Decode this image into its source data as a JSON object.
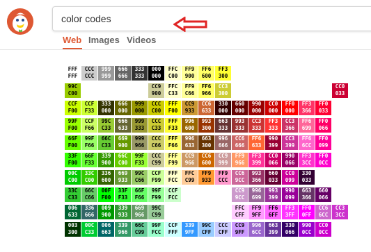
{
  "search": {
    "query": "color codes"
  },
  "tabs": [
    {
      "label": "Web",
      "active": true
    },
    {
      "label": "Images",
      "active": false
    },
    {
      "label": "Videos",
      "active": false
    }
  ],
  "colors": {
    "accent": "#de5833",
    "arrow": "#e02424"
  },
  "color_chart": {
    "rows": [
      [
        [
          "FFF",
          "FFF",
          "FFF",
          "#000"
        ],
        [
          "CCC",
          "CCC",
          "CCC",
          "#000"
        ],
        [
          "999",
          "999",
          "999",
          "#fff"
        ],
        [
          "666",
          "666",
          "666",
          "#fff"
        ],
        [
          "333",
          "333",
          "333",
          "#fff"
        ],
        [
          "000",
          "000",
          "000",
          "#fff"
        ],
        [
          "FFC",
          "C00",
          "FFC",
          "#000"
        ],
        [
          "FF9",
          "900",
          "FF9",
          "#000"
        ],
        [
          "FF6",
          "600",
          "FF6",
          "#000"
        ],
        [
          "FF3",
          "300",
          "FF3",
          "#000"
        ]
      ],
      [
        [
          "99C",
          "C00",
          "9C0",
          "#000"
        ],
        null,
        null,
        null,
        null,
        [
          "CC9",
          "900",
          "CC9",
          "#000"
        ],
        [
          "FFC",
          "C33",
          "FFC",
          "#000"
        ],
        [
          "FF9",
          "C66",
          "FF9",
          "#000"
        ],
        [
          "FF6",
          "966",
          "FF6",
          "#000"
        ],
        [
          "CC3",
          "300",
          "CC3",
          "#fff"
        ],
        null,
        null,
        null,
        null,
        null,
        null,
        [
          "CC0",
          "033",
          "C03",
          "#fff"
        ]
      ],
      [
        [
          "CCF",
          "F00",
          "CF0",
          "#000"
        ],
        [
          "CCF",
          "F33",
          "CF3",
          "#000"
        ],
        [
          "333",
          "000",
          "330",
          "#fff"
        ],
        [
          "666",
          "000",
          "660",
          "#fff"
        ],
        [
          "999",
          "000",
          "990",
          "#000"
        ],
        [
          "CCC",
          "C00",
          "CC0",
          "#000"
        ],
        [
          "FFF",
          "F00",
          "FF0",
          "#000"
        ],
        [
          "CC9",
          "933",
          "C93",
          "#000"
        ],
        [
          "CC6",
          "633",
          "C63",
          "#fff"
        ],
        [
          "330",
          "000",
          "300",
          "#fff"
        ],
        [
          "660",
          "000",
          "600",
          "#fff"
        ],
        [
          "990",
          "000",
          "900",
          "#fff"
        ],
        [
          "CC0",
          "000",
          "C00",
          "#fff"
        ],
        [
          "FF0",
          "000",
          "F00",
          "#fff"
        ],
        [
          "FF3",
          "366",
          "F36",
          "#fff"
        ],
        [
          "FF0",
          "033",
          "F03",
          "#fff"
        ]
      ],
      [
        [
          "99F",
          "F00",
          "9F0",
          "#000"
        ],
        [
          "CCF",
          "F66",
          "CF6",
          "#000"
        ],
        [
          "99C",
          "C33",
          "9C3",
          "#000"
        ],
        [
          "666",
          "633",
          "663",
          "#fff"
        ],
        [
          "999",
          "333",
          "993",
          "#000"
        ],
        [
          "CCC",
          "C33",
          "CC3",
          "#000"
        ],
        [
          "FFF",
          "F33",
          "FF3",
          "#000"
        ],
        [
          "996",
          "600",
          "960",
          "#fff"
        ],
        [
          "993",
          "300",
          "930",
          "#fff"
        ],
        [
          "663",
          "333",
          "633",
          "#fff"
        ],
        [
          "993",
          "333",
          "933",
          "#fff"
        ],
        [
          "CC3",
          "333",
          "C33",
          "#fff"
        ],
        [
          "FF3",
          "333",
          "F33",
          "#fff"
        ],
        [
          "CC3",
          "366",
          "C36",
          "#fff"
        ],
        [
          "FF6",
          "699",
          "F69",
          "#fff"
        ],
        [
          "FF0",
          "066",
          "F06",
          "#fff"
        ]
      ],
      [
        [
          "66F",
          "F00",
          "6F0",
          "#000"
        ],
        [
          "99F",
          "F66",
          "9F6",
          "#000"
        ],
        [
          "66C",
          "C33",
          "6C3",
          "#000"
        ],
        [
          "669",
          "900",
          "690",
          "#fff"
        ],
        [
          "999",
          "966",
          "996",
          "#000"
        ],
        [
          "CCC",
          "C66",
          "CC6",
          "#000"
        ],
        [
          "FFF",
          "F66",
          "FF6",
          "#000"
        ],
        [
          "996",
          "633",
          "963",
          "#fff"
        ],
        [
          "663",
          "300",
          "630",
          "#fff"
        ],
        [
          "996",
          "666",
          "966",
          "#fff"
        ],
        [
          "CC6",
          "666",
          "C66",
          "#fff"
        ],
        [
          "FF6",
          "633",
          "F63",
          "#fff"
        ],
        [
          "990",
          "399",
          "903",
          "#fff"
        ],
        [
          "CC3",
          "399",
          "C39",
          "#fff"
        ],
        [
          "FF6",
          "6CC",
          "F6C",
          "#fff"
        ],
        [
          "FF0",
          "099",
          "F09",
          "#fff"
        ]
      ],
      [
        [
          "33F",
          "F00",
          "3F0",
          "#000"
        ],
        [
          "66F",
          "F33",
          "6F3",
          "#000"
        ],
        [
          "339",
          "900",
          "390",
          "#fff"
        ],
        [
          "66C",
          "C00",
          "6C0",
          "#fff"
        ],
        [
          "99F",
          "F33",
          "9F3",
          "#000"
        ],
        [
          "CCC",
          "C99",
          "CC9",
          "#000"
        ],
        [
          "FFF",
          "F99",
          "FF9",
          "#000"
        ],
        [
          "CC9",
          "966",
          "C96",
          "#fff"
        ],
        [
          "CC6",
          "600",
          "C60",
          "#fff"
        ],
        [
          "CC9",
          "999",
          "C99",
          "#fff"
        ],
        [
          "FF9",
          "966",
          "F96",
          "#fff"
        ],
        [
          "FF3",
          "399",
          "F39",
          "#fff"
        ],
        [
          "CC0",
          "066",
          "C06",
          "#fff"
        ],
        [
          "990",
          "066",
          "906",
          "#fff"
        ],
        [
          "FF3",
          "3CC",
          "F3C",
          "#fff"
        ],
        [
          "FF0",
          "0CC",
          "F0C",
          "#fff"
        ]
      ],
      [
        [
          "00C",
          "C00",
          "0C0",
          "#fff"
        ],
        [
          "33C",
          "C00",
          "3C0",
          "#fff"
        ],
        [
          "336",
          "600",
          "360",
          "#fff"
        ],
        [
          "669",
          "933",
          "693",
          "#fff"
        ],
        [
          "99C",
          "C66",
          "9C6",
          "#000"
        ],
        [
          "CCF",
          "F99",
          "CF9",
          "#000"
        ],
        [
          "FFF",
          "FCC",
          "FFC",
          "#000"
        ],
        [
          "FFC",
          "C99",
          "FC9",
          "#000"
        ],
        [
          "FF9",
          "933",
          "F93",
          "#000"
        ],
        [
          "FF9",
          "CCC",
          "F9C",
          "#000"
        ],
        [
          "CC6",
          "9CC",
          "C69",
          "#fff"
        ],
        [
          "993",
          "366",
          "936",
          "#fff"
        ],
        [
          "660",
          "033",
          "603",
          "#fff"
        ],
        [
          "CC0",
          "099",
          "C09",
          "#fff"
        ],
        [
          "330",
          "033",
          "303",
          "#fff"
        ]
      ],
      [
        [
          "33C",
          "C33",
          "3C3",
          "#000"
        ],
        [
          "66C",
          "C66",
          "6C6",
          "#000"
        ],
        [
          "00F",
          "F00",
          "0F0",
          "#000"
        ],
        [
          "33F",
          "F33",
          "3F3",
          "#000"
        ],
        [
          "66F",
          "F66",
          "6F6",
          "#000"
        ],
        [
          "99F",
          "F99",
          "9F9",
          "#000"
        ],
        [
          "CCF",
          "FCC",
          "CFC",
          "#000"
        ],
        null,
        null,
        null,
        [
          "CC9",
          "9CC",
          "C9C",
          "#fff"
        ],
        [
          "996",
          "699",
          "969",
          "#fff"
        ],
        [
          "993",
          "399",
          "939",
          "#fff"
        ],
        [
          "990",
          "099",
          "909",
          "#fff"
        ],
        [
          "663",
          "366",
          "636",
          "#fff"
        ],
        [
          "660",
          "066",
          "606",
          "#fff"
        ]
      ],
      [
        [
          "006",
          "633",
          "063",
          "#fff"
        ],
        [
          "336",
          "666",
          "366",
          "#fff"
        ],
        [
          "009",
          "900",
          "090",
          "#fff"
        ],
        [
          "339",
          "933",
          "393",
          "#fff"
        ],
        [
          "669",
          "966",
          "696",
          "#fff"
        ],
        [
          "99C",
          "C99",
          "9C9",
          "#000"
        ],
        null,
        null,
        null,
        null,
        [
          "FFC",
          "CFF",
          "FCF",
          "#000"
        ],
        [
          "FF9",
          "9FF",
          "F9F",
          "#000"
        ],
        [
          "FF6",
          "6FF",
          "F6F",
          "#000"
        ],
        [
          "FF3",
          "3FF",
          "F3F",
          "#fff"
        ],
        [
          "FF0",
          "0FF",
          "F0F",
          "#fff"
        ],
        [
          "CC6",
          "6CC",
          "C6C",
          "#fff"
        ],
        [
          "CC3",
          "3CC",
          "C3C",
          "#fff"
        ]
      ],
      [
        [
          "003",
          "300",
          "030",
          "#fff"
        ],
        [
          "00C",
          "C33",
          "0C3",
          "#fff"
        ],
        [
          "006",
          "663",
          "066",
          "#fff"
        ],
        [
          "339",
          "966",
          "396",
          "#fff"
        ],
        [
          "66C",
          "C99",
          "6C9",
          "#000"
        ],
        [
          "99F",
          "FCC",
          "9FC",
          "#000"
        ],
        [
          "CCF",
          "FFF",
          "CFF",
          "#000"
        ],
        [
          "339",
          "9FF",
          "39F",
          "#fff"
        ],
        [
          "99C",
          "CFF",
          "9CF",
          "#000"
        ],
        [
          "CCC",
          "CFF",
          "CCF",
          "#000"
        ],
        [
          "CC9",
          "9FF",
          "C9F",
          "#000"
        ],
        [
          "996",
          "6CC",
          "96C",
          "#fff"
        ],
        [
          "663",
          "399",
          "639",
          "#fff"
        ],
        [
          "330",
          "066",
          "306",
          "#fff"
        ],
        [
          "990",
          "0CC",
          "90C",
          "#fff"
        ],
        [
          "CC0",
          "0CC",
          "C0C",
          "#fff"
        ]
      ]
    ]
  }
}
